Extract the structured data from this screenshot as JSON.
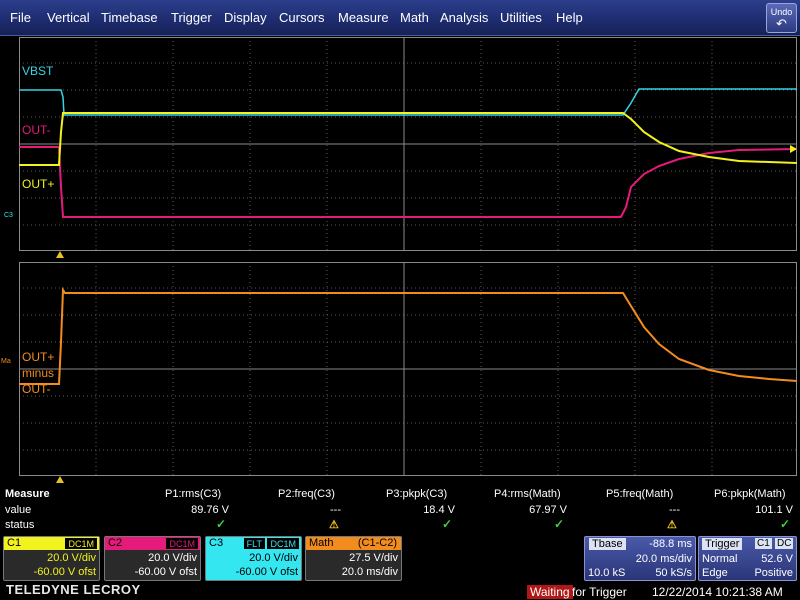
{
  "menu": {
    "items": [
      "File",
      "Vertical",
      "Timebase",
      "Trigger",
      "Display",
      "Cursors",
      "Measure",
      "Math",
      "Analysis",
      "Utilities",
      "Help"
    ],
    "undo_label": "Undo"
  },
  "upper_grid": {
    "traces": [
      {
        "label": "VBST",
        "color": "#33d6e6"
      },
      {
        "label": "OUT-",
        "color": "#e61a7a"
      },
      {
        "label": "OUT+",
        "color": "#f2f21e"
      }
    ],
    "channel_marker": "C3"
  },
  "lower_grid": {
    "trace_label_lines": [
      "OUT+",
      "minus",
      "OUT-"
    ],
    "color": "#f28c1e",
    "channel_marker": "Ma"
  },
  "measure": {
    "title": "Measure",
    "row_labels": [
      "value",
      "status"
    ],
    "params": [
      {
        "name": "P1:rms(C3)",
        "value": "89.76 V",
        "status": "ok"
      },
      {
        "name": "P2:freq(C3)",
        "value": "---",
        "status": "warn"
      },
      {
        "name": "P3:pkpk(C3)",
        "value": "18.4 V",
        "status": "ok"
      },
      {
        "name": "P4:rms(Math)",
        "value": "67.97 V",
        "status": "ok"
      },
      {
        "name": "P5:freq(Math)",
        "value": "---",
        "status": "warn"
      },
      {
        "name": "P6:pkpk(Math)",
        "value": "101.1 V",
        "status": "ok"
      }
    ]
  },
  "channels": {
    "c1": {
      "name": "C1",
      "coupling": "DC1M",
      "scale": "20.0 V/div",
      "offset": "-60.00 V ofst",
      "color": "#f2f21e"
    },
    "c2": {
      "name": "C2",
      "coupling": "DC1M",
      "scale": "20.0 V/div",
      "offset": "-60.00 V ofst",
      "color": "#e61a7a"
    },
    "c3": {
      "name": "C3",
      "filter": "FLT",
      "coupling": "DC1M",
      "scale": "20.0 V/div",
      "offset": "-60.00 V ofst",
      "color": "#33e6f0"
    },
    "math": {
      "name": "Math",
      "formula": "(C1-C2)",
      "scale": "27.5 V/div",
      "timebase": "20.0 ms/div",
      "color": "#f28c1e"
    }
  },
  "timebase": {
    "label": "Tbase",
    "delay": "-88.8 ms",
    "per_div": "20.0 ms/div",
    "samples": "10.0 kS",
    "rate": "50 kS/s"
  },
  "trigger": {
    "label": "Trigger",
    "source": "C1",
    "coupling": "DC",
    "mode": "Normal",
    "level": "52.6 V",
    "type": "Edge",
    "slope": "Positive"
  },
  "status_bar": {
    "brand": "TELEDYNE LECROY",
    "state": "Waiting",
    "state_suffix": "for Trigger",
    "timestamp": "12/22/2014 10:21:38 AM"
  }
}
